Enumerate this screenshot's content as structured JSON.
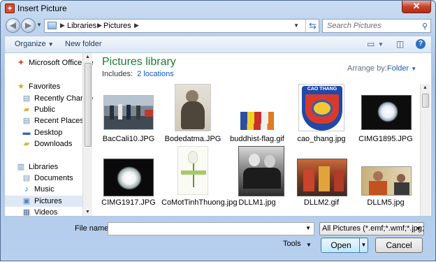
{
  "window": {
    "title": "Insert Picture",
    "close_label": "✕"
  },
  "address": {
    "crumbs": [
      "Libraries",
      "Pictures"
    ],
    "search_placeholder": "Search Pictures"
  },
  "toolbar": {
    "organize_label": "Organize",
    "new_folder_label": "New folder"
  },
  "nav": {
    "items": [
      {
        "label": "Microsoft Office Pe",
        "icon": "office-icon"
      },
      {
        "label": "Favorites",
        "icon": "star-icon"
      },
      {
        "label": "Recently Changed",
        "icon": "recent-icon"
      },
      {
        "label": "Public",
        "icon": "folder-icon"
      },
      {
        "label": "Recent Places",
        "icon": "recent-places-icon"
      },
      {
        "label": "Desktop",
        "icon": "desktop-icon"
      },
      {
        "label": "Downloads",
        "icon": "downloads-icon"
      },
      {
        "label": "Libraries",
        "icon": "libraries-icon"
      },
      {
        "label": "Documents",
        "icon": "documents-icon"
      },
      {
        "label": "Music",
        "icon": "music-icon"
      },
      {
        "label": "Pictures",
        "icon": "pictures-icon",
        "selected": true
      },
      {
        "label": "Videos",
        "icon": "videos-icon"
      }
    ]
  },
  "library": {
    "title": "Pictures library",
    "includes_label": "Includes:",
    "locations_link": "2 locations",
    "arrange_label": "Arrange by:",
    "arrange_value": "Folder"
  },
  "files": [
    {
      "name": "BacCali10.JPG"
    },
    {
      "name": "Bodedatma.JPG"
    },
    {
      "name": "buddhist-flag.gif"
    },
    {
      "name": "cao_thang.jpg"
    },
    {
      "name": "CIMG1895.JPG"
    },
    {
      "name": "CIMG1917.JPG"
    },
    {
      "name": "CoMotTinhThuong.jpg"
    },
    {
      "name": "DLLM1.jpg"
    },
    {
      "name": "DLLM2.gif"
    },
    {
      "name": "DLLM5.jpg"
    }
  ],
  "badge_text": "CAO THANG",
  "bottom": {
    "file_name_label": "File name:",
    "file_name_value": "",
    "filter": "All Pictures (*.emf;*.wmf;*.jpg;*",
    "tools_label": "Tools",
    "open_label": "Open",
    "cancel_label": "Cancel"
  },
  "colors": {
    "library_title": "#1e7a2e",
    "link": "#0b55c4",
    "close": "#c7432d"
  }
}
